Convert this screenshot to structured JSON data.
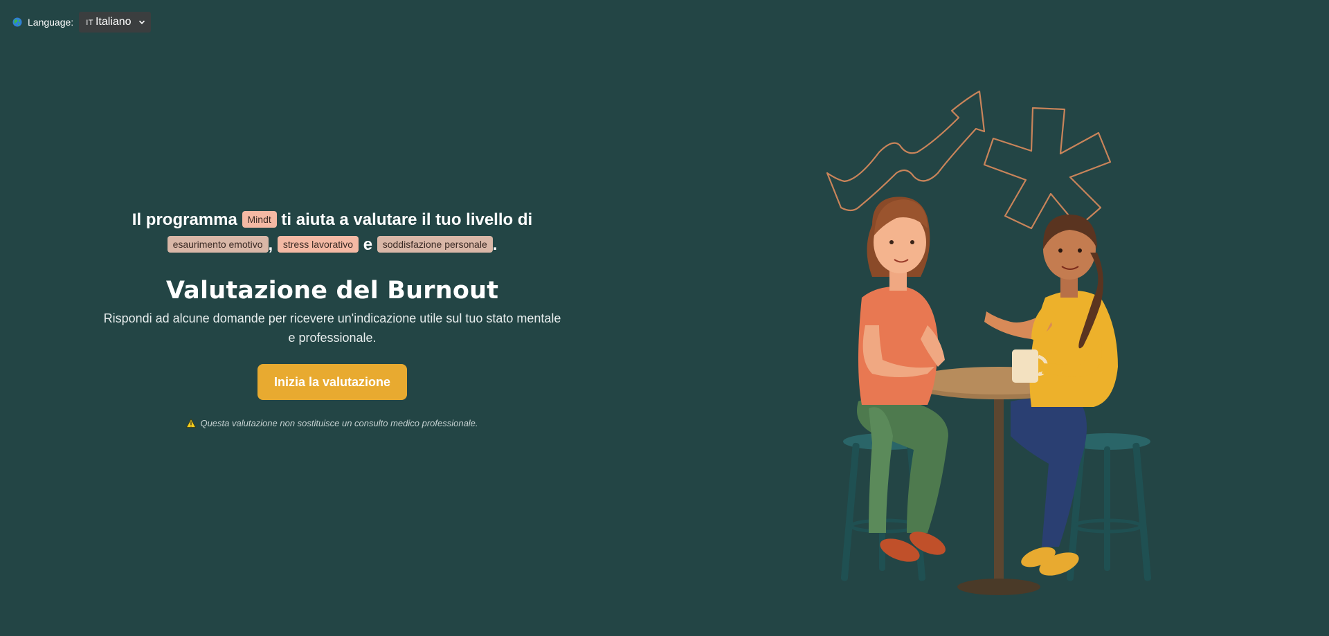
{
  "language": {
    "label": "Language:",
    "flag_code": "IT",
    "selected": "Italiano"
  },
  "hero": {
    "intro_prefix": "Il programma",
    "program_name": "Mindt",
    "intro_middle": "ti aiuta a valutare il tuo livello di",
    "tag_emotional": "esaurimento emotivo",
    "comma": ",",
    "tag_stress": "stress lavorativo",
    "and": "e",
    "tag_satisfaction": "soddisfazione personale",
    "period": ".",
    "title": "Valutazione del Burnout",
    "subtitle": "Rispondi ad alcune domande per ricevere un'indicazione utile sul tuo stato mentale e professionale.",
    "cta_label": "Inizia la valutazione",
    "disclaimer": "Questa valutazione non sostituisce un consulto medico professionale."
  },
  "colors": {
    "background": "#234545",
    "accent": "#e8aa30",
    "tag_pink": "#f4b9a4",
    "tag_beige": "#d9b7a7",
    "line_art": "#c9845a"
  },
  "icons": {
    "globe": "globe-icon",
    "dropdown": "chevron-down-icon",
    "warning": "warning-icon"
  }
}
